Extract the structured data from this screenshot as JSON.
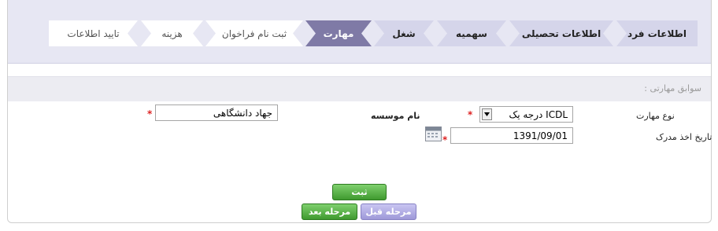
{
  "steps": [
    {
      "label": "اطلاعات فرد",
      "state": "done"
    },
    {
      "label": "اطلاعات تحصیلی",
      "state": "done"
    },
    {
      "label": "سهمیه",
      "state": "done"
    },
    {
      "label": "شغل",
      "state": "done"
    },
    {
      "label": "مهارت",
      "state": "active"
    },
    {
      "label": "ثبت نام فراخوان",
      "state": "pending"
    },
    {
      "label": "هزینه",
      "state": "pending"
    },
    {
      "label": "تایید اطلاعات",
      "state": "pending"
    }
  ],
  "section": {
    "title": "سوابق مهارتی :"
  },
  "form": {
    "skill_type_label": "نوع مهارت",
    "skill_type_value": "ICDL درجه یک",
    "institute_label": "نام موسسه",
    "institute_value": "جهاد دانشگاهی",
    "issue_date_label": "تاریخ اخذ مدرک",
    "issue_date_value": "1391/09/01",
    "required_mark": "*"
  },
  "buttons": {
    "submit": "ثبت",
    "previous": "مرحله قبل",
    "next": "مرحله بعد"
  },
  "colors": {
    "step_done": "#d5d5ea",
    "step_active": "#7f7aa6",
    "button_green": "#3f9a2f",
    "button_purple": "#9e99d8"
  }
}
